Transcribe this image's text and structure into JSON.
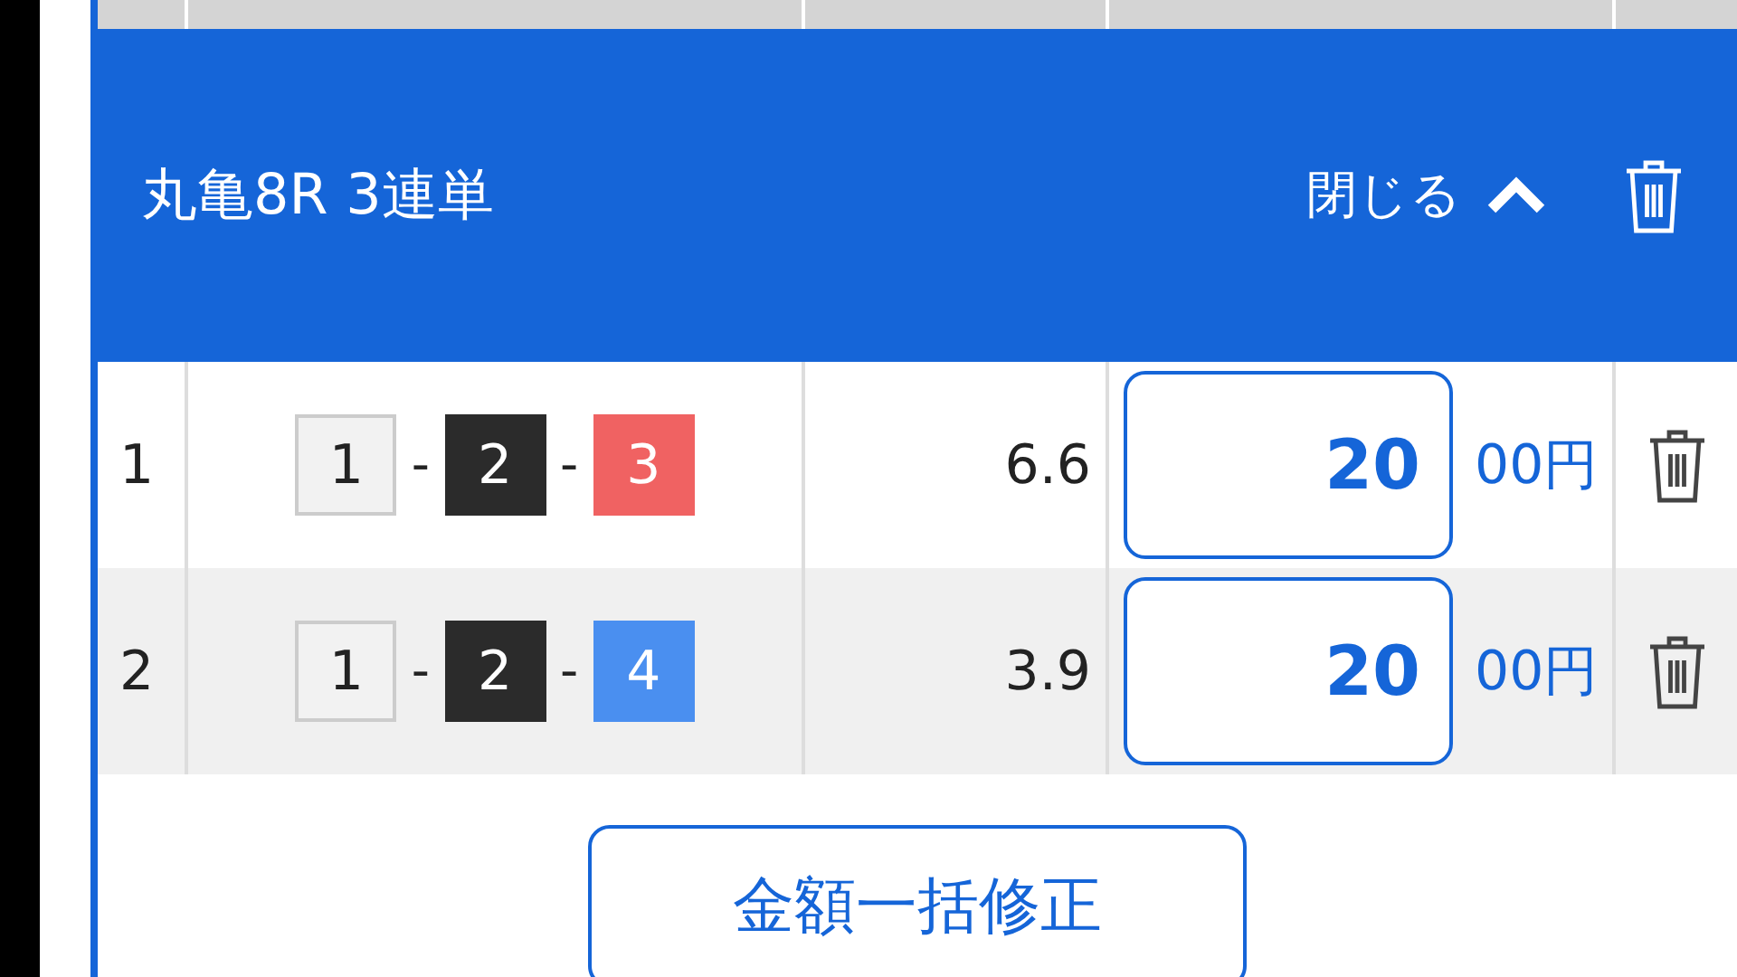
{
  "panel": {
    "title": "丸亀8R 3連単",
    "close_label": "閉じる",
    "expanded": true
  },
  "rows": [
    {
      "no": "1",
      "boxes": [
        {
          "text": "1",
          "color": "#f2f2f2"
        },
        {
          "text": "2",
          "color": "#2b2b2b"
        },
        {
          "text": "3",
          "color": "#f06262"
        }
      ],
      "separator": "-",
      "odds": "6.6",
      "amount": "20",
      "unit": "00円"
    },
    {
      "no": "2",
      "boxes": [
        {
          "text": "1",
          "color": "#f2f2f2"
        },
        {
          "text": "2",
          "color": "#2b2b2b"
        },
        {
          "text": "4",
          "color": "#4a8ff0"
        }
      ],
      "separator": "-",
      "odds": "3.9",
      "amount": "20",
      "unit": "00円"
    }
  ],
  "bulk_button": "金額一括修正"
}
